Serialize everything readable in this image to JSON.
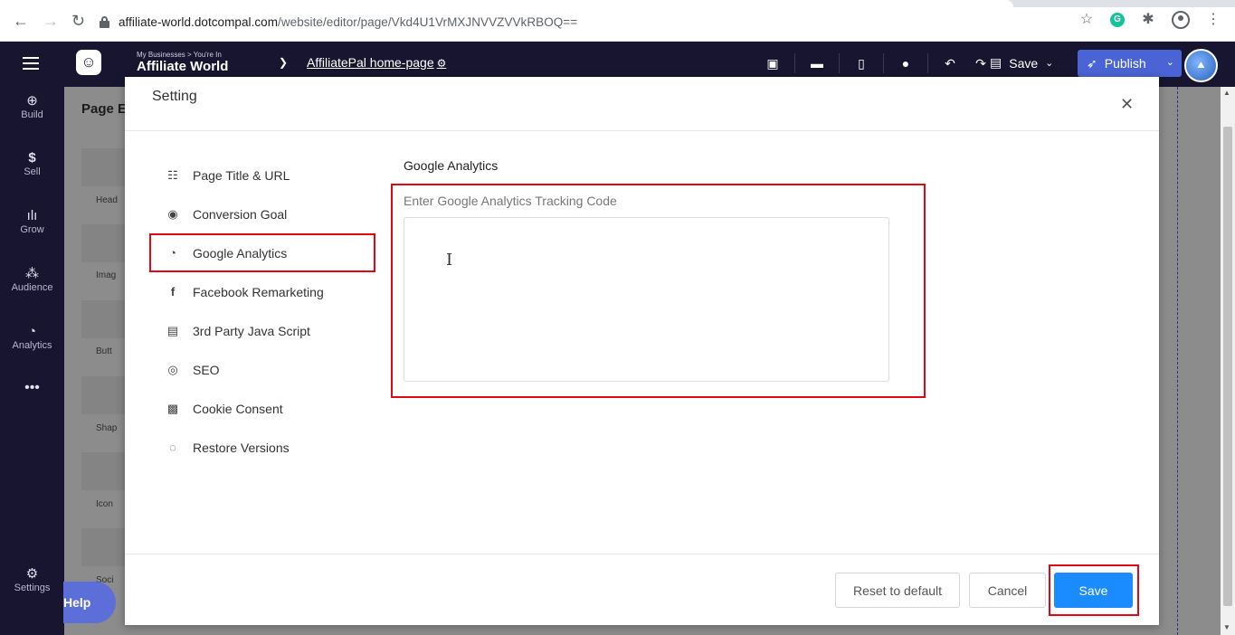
{
  "browser": {
    "url_host": "affiliate-world.dotcompal.com",
    "url_path": "/website/editor/page/Vkd4U1VrMXJNVVZVVkRBOQ=="
  },
  "topbar": {
    "biz_small": "My Businesses > You're In",
    "biz_name": "Affiliate World",
    "page_name": "AffiliatePal home-page",
    "save_label": "Save",
    "publish_label": "Publish"
  },
  "sidebar": {
    "build": "Build",
    "sell": "Sell",
    "grow": "Grow",
    "audience": "Audience",
    "analytics": "Analytics",
    "settings": "Settings",
    "help": "Help"
  },
  "behind": {
    "panel_title": "Page E",
    "tiles": [
      "Head",
      "Imag",
      "Butt",
      "Shap",
      "Icon",
      "Soci"
    ]
  },
  "modal": {
    "title": "Setting",
    "menu": [
      {
        "label": "Page Title & URL",
        "icon": "list-icon"
      },
      {
        "label": "Conversion Goal",
        "icon": "target-icon"
      },
      {
        "label": "Google Analytics",
        "icon": "analytics-icon"
      },
      {
        "label": "Facebook Remarketing",
        "icon": "facebook-icon"
      },
      {
        "label": "3rd Party Java Script",
        "icon": "script-icon"
      },
      {
        "label": "SEO",
        "icon": "search-icon"
      },
      {
        "label": "Cookie Consent",
        "icon": "cookie-icon"
      },
      {
        "label": "Restore Versions",
        "icon": "restore-icon"
      }
    ],
    "content_label": "Google Analytics",
    "field_label": "Enter Google Analytics Tracking Code",
    "field_value": "",
    "reset_label": "Reset to default",
    "cancel_label": "Cancel",
    "save_label": "Save"
  },
  "colors": {
    "nav_bg": "#171530",
    "primary": "#1a8cff",
    "publish": "#4a64d6",
    "highlight": "#e30613"
  }
}
